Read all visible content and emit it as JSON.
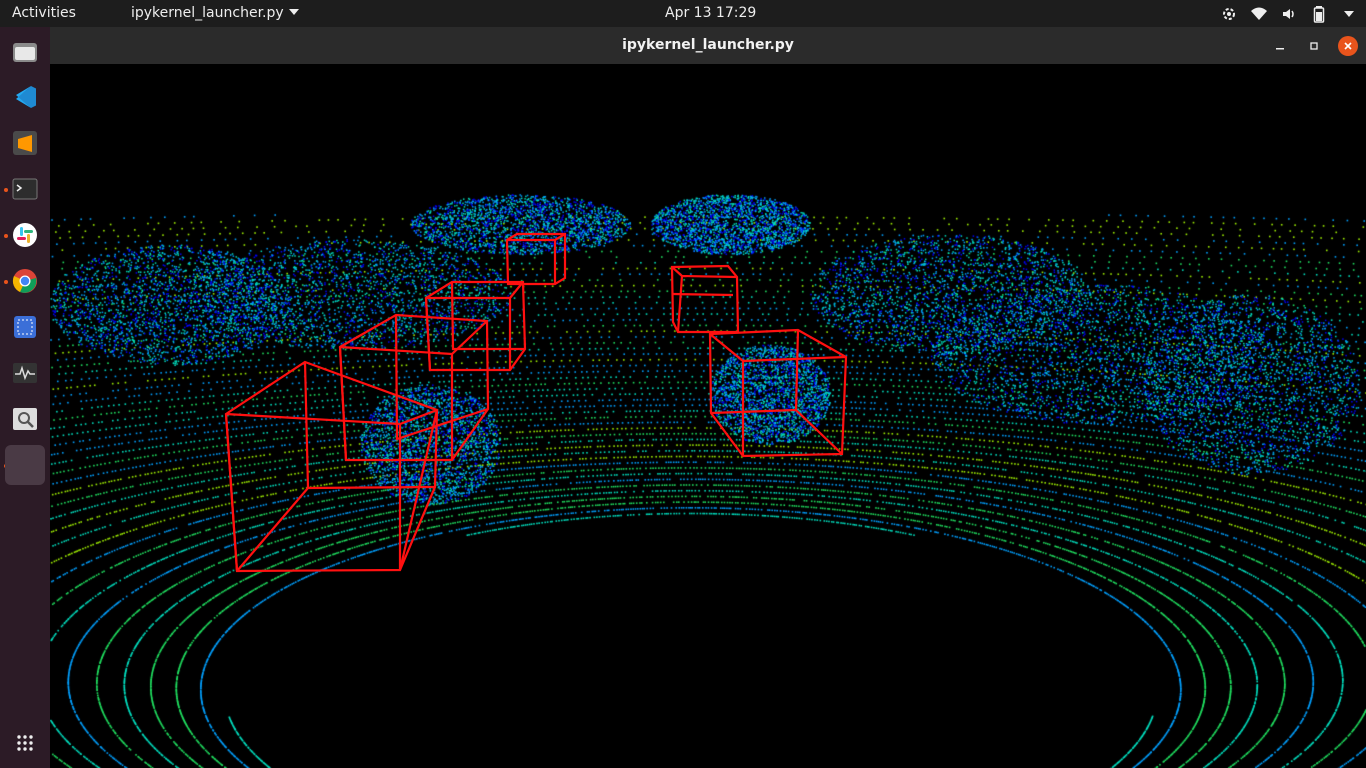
{
  "topbar": {
    "activities": "Activities",
    "app_menu": "ipykernel_launcher.py",
    "clock": "Apr 13  17:29",
    "tray": [
      "network-activity-icon",
      "wifi-icon",
      "volume-icon",
      "battery-icon",
      "system-menu-caret-icon"
    ]
  },
  "dock": {
    "items": [
      {
        "name": "files",
        "icon": "folder-icon",
        "running": false
      },
      {
        "name": "vscode",
        "icon": "vscode-icon",
        "running": false
      },
      {
        "name": "sublime-text",
        "icon": "sublime-icon",
        "running": false
      },
      {
        "name": "terminal",
        "icon": "terminal-icon",
        "running": true
      },
      {
        "name": "slack",
        "icon": "slack-icon",
        "running": true
      },
      {
        "name": "chrome",
        "icon": "chrome-icon",
        "running": true
      },
      {
        "name": "screenshot",
        "icon": "screenshot-icon",
        "running": false
      },
      {
        "name": "system-monitor",
        "icon": "monitor-icon",
        "running": false
      },
      {
        "name": "image-viewer",
        "icon": "image-viewer-icon",
        "running": false
      },
      {
        "name": "python-window",
        "icon": "blank-app-icon",
        "running": true,
        "active": true
      }
    ],
    "show_apps": "apps-grid-icon"
  },
  "window": {
    "title": "ipykernel_launcher.py",
    "controls": [
      "minimize-icon",
      "maximize-icon",
      "close-icon"
    ],
    "close_color": "#e9541c"
  },
  "viewer": {
    "background": "#000000",
    "box_color": "#ff0000",
    "colormap": [
      "#0000ff",
      "#00a0ff",
      "#00e0c0",
      "#20e060",
      "#a0f000"
    ],
    "bounding_boxes": 6
  }
}
